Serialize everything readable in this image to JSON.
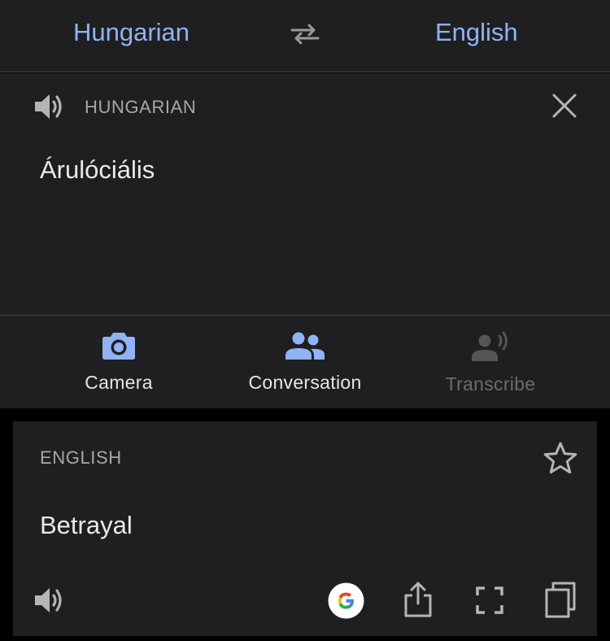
{
  "language_bar": {
    "source_language": "Hungarian",
    "target_language": "English",
    "swap_icon": "swap-arrows-icon"
  },
  "input_panel": {
    "language_caption": "HUNGARIAN",
    "text": "Árulóciális",
    "speaker_icon": "speaker-icon",
    "clear_icon": "close-icon"
  },
  "tools": [
    {
      "label": "Camera",
      "icon": "camera-icon",
      "enabled": true
    },
    {
      "label": "Conversation",
      "icon": "people-icon",
      "enabled": true
    },
    {
      "label": "Transcribe",
      "icon": "transcribe-icon",
      "enabled": false
    }
  ],
  "result_card": {
    "language_caption": "ENGLISH",
    "text": "Betrayal",
    "star_icon": "star-outline-icon",
    "actions": [
      "speaker-icon",
      "google-logo-icon",
      "share-icon",
      "fullscreen-icon",
      "copy-icon"
    ]
  },
  "colors": {
    "background": "#000000",
    "surface": "#1f1f21",
    "accent": "#8fb3f5",
    "divider": "#48484b",
    "secondary_text": "#a7a7ab",
    "disabled": "#6c6c70"
  }
}
